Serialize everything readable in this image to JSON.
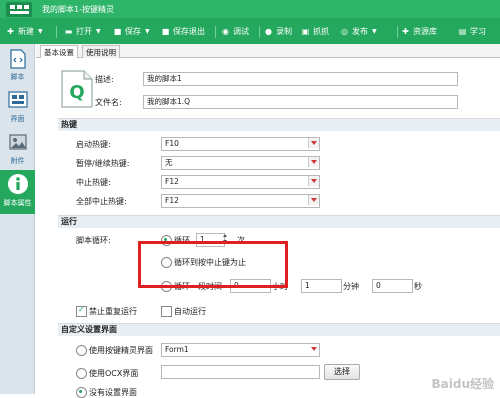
{
  "window": {
    "title": "我的脚本1-按键精灵"
  },
  "menu": [
    {
      "label": "新建",
      "icon": "plus-icon",
      "dropdown": true
    },
    {
      "label": "打开",
      "icon": "folder-icon",
      "dropdown": true
    },
    {
      "label": "保存",
      "icon": "save-icon",
      "dropdown": true
    },
    {
      "label": "保存退出",
      "icon": "save-exit-icon",
      "dropdown": false
    },
    {
      "label": "调试",
      "icon": "debug-icon",
      "dropdown": false
    },
    {
      "label": "录制",
      "icon": "record-icon",
      "dropdown": false
    },
    {
      "label": "抓抓",
      "icon": "capture-icon",
      "dropdown": false
    },
    {
      "label": "发布",
      "icon": "publish-icon",
      "dropdown": true
    },
    {
      "label": "资源库",
      "icon": "resource-icon",
      "dropdown": false
    },
    {
      "label": "学习",
      "icon": "learn-icon",
      "dropdown": false
    }
  ],
  "sidebar": [
    {
      "label": "脚本",
      "icon": "script-icon",
      "active": false
    },
    {
      "label": "界面",
      "icon": "interface-icon",
      "active": false
    },
    {
      "label": "附件",
      "icon": "attachment-icon",
      "active": false
    },
    {
      "label": "脚本属性",
      "icon": "info-icon",
      "active": true
    }
  ],
  "tabs": [
    {
      "label": "基本设置",
      "active": true
    },
    {
      "label": "使用说明",
      "active": false
    }
  ],
  "basic": {
    "desc_label": "描述:",
    "desc_value": "我的脚本1",
    "file_label": "文件名:",
    "file_value": "我的脚本1.Q",
    "file_icon_letter": "Q"
  },
  "hotkeys": {
    "title": "热键",
    "rows": [
      {
        "label": "启动热键:",
        "value": "F10"
      },
      {
        "label": "暂停/继续热键:",
        "value": "无"
      },
      {
        "label": "中止热键:",
        "value": "F12"
      },
      {
        "label": "全部中止热键:",
        "value": "F12"
      }
    ]
  },
  "run": {
    "title": "运行",
    "loop_label": "脚本循环:",
    "loop_count_option": "循环",
    "loop_count_value": "1",
    "loop_count_unit": "次",
    "loop_until_option": "循环到按中止键为止",
    "loop_time_option": "循环一段时间",
    "hours_value": "0",
    "hours_unit": "小时",
    "minutes_value": "1",
    "minutes_unit": "分钟",
    "seconds_value": "0",
    "seconds_unit": "秒",
    "no_repeat_label": "禁止重复运行",
    "auto_run_label": "自动运行"
  },
  "custom_ui": {
    "title": "自定义设置界面",
    "opt1_label": "使用按键精灵界面",
    "opt1_value": "Form1",
    "opt2_label": "使用OCX界面",
    "opt2_value": "",
    "browse_label": "选择",
    "opt3_label": "没有设置界面"
  },
  "watermark": "Baidu经验",
  "colors": {
    "accent": "#23a85e",
    "highlight": "#e02020"
  }
}
